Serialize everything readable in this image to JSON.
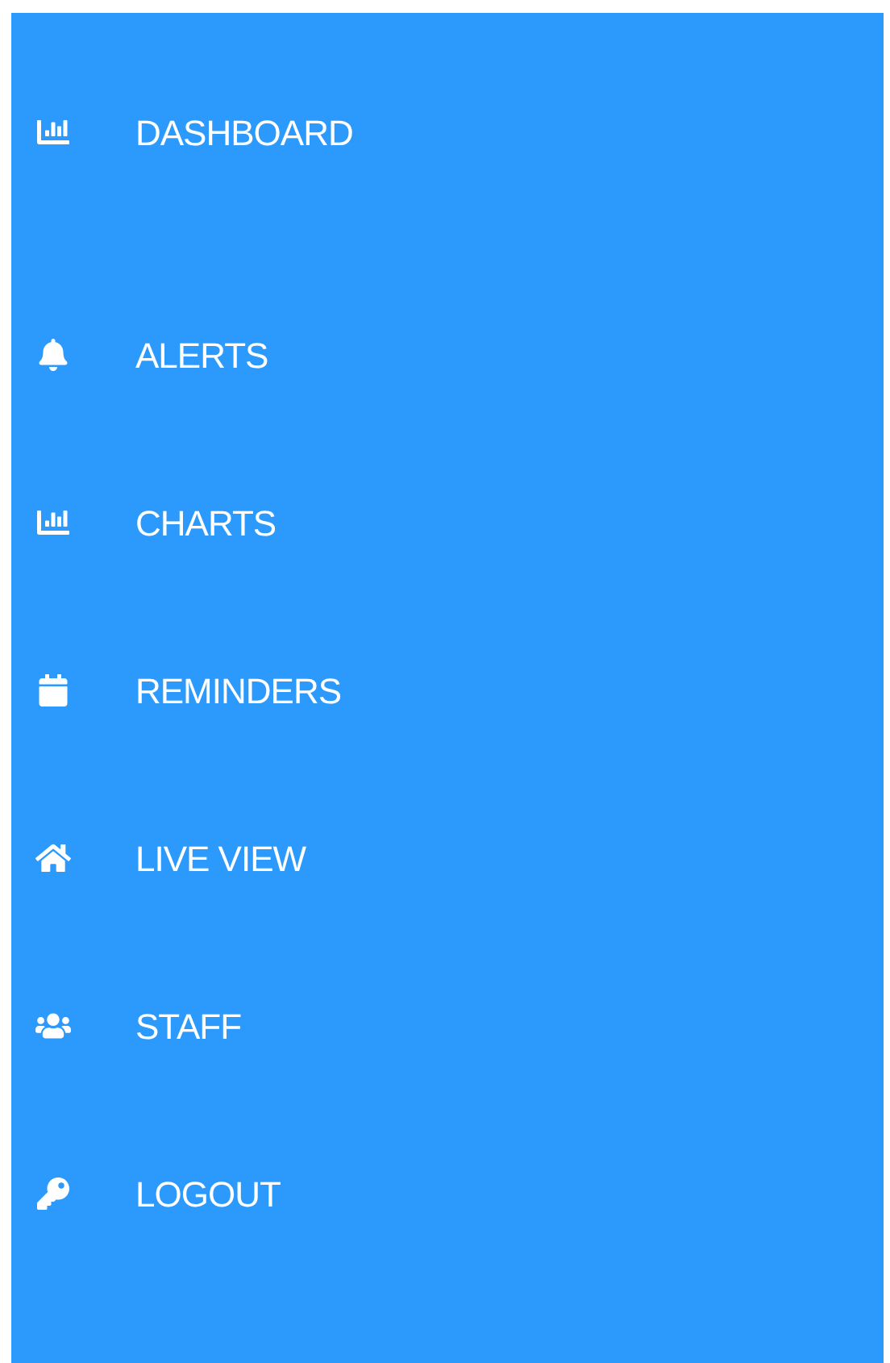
{
  "sidebar": {
    "items": [
      {
        "kind": "chart",
        "label": "DASHBOARD"
      },
      {
        "kind": "bell",
        "label": "ALERTS"
      },
      {
        "kind": "chart",
        "label": "CHARTS"
      },
      {
        "kind": "calendar",
        "label": "REMINDERS"
      },
      {
        "kind": "home",
        "label": "LIVE VIEW"
      },
      {
        "kind": "users",
        "label": "STAFF"
      },
      {
        "kind": "key",
        "label": "LOGOUT"
      }
    ]
  }
}
